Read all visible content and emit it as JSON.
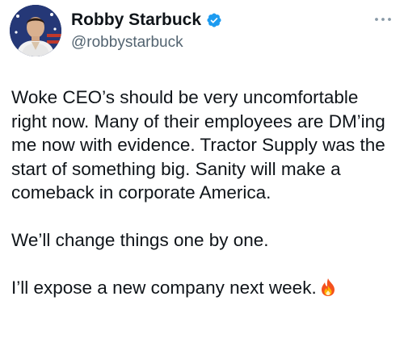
{
  "author": {
    "display_name": "Robby Starbuck",
    "handle": "@robbystarbuck",
    "verified_icon": "verified-badge-icon",
    "verified_color": "#1d9bf0"
  },
  "tweet": {
    "paragraphs": [
      "Woke CEO’s should be very uncomfortable right now. Many of their employees are DM’ing me now with evidence. Tractor Supply was the start of something big. Sanity will make a comeback in corporate America.",
      "We’ll change things one by one.",
      "I’ll expose a new company next week."
    ],
    "trailing_emoji": "fire-icon"
  },
  "menu": {
    "icon": "more-dots-icon"
  },
  "colors": {
    "text_primary": "#0f1419",
    "text_secondary": "#536471"
  }
}
